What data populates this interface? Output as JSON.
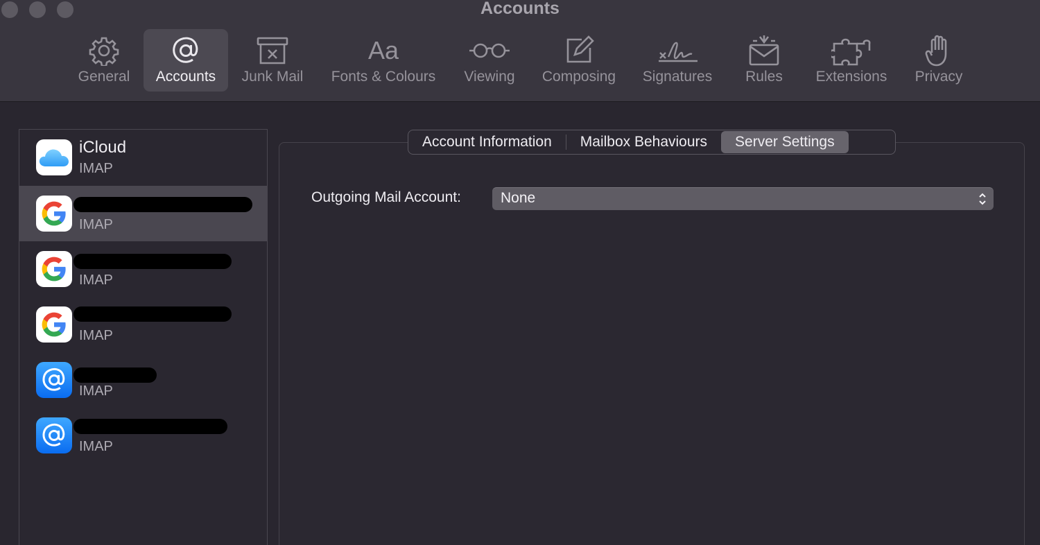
{
  "window": {
    "title": "Accounts"
  },
  "toolbar": {
    "items": [
      {
        "label": "General",
        "icon": "gear-icon"
      },
      {
        "label": "Accounts",
        "icon": "at-icon",
        "active": true
      },
      {
        "label": "Junk Mail",
        "icon": "junk-bin-icon"
      },
      {
        "label": "Fonts & Colours",
        "icon": "fonts-icon"
      },
      {
        "label": "Viewing",
        "icon": "glasses-icon"
      },
      {
        "label": "Composing",
        "icon": "compose-icon"
      },
      {
        "label": "Signatures",
        "icon": "signature-icon"
      },
      {
        "label": "Rules",
        "icon": "rules-envelope-icon"
      },
      {
        "label": "Extensions",
        "icon": "puzzle-icon"
      },
      {
        "label": "Privacy",
        "icon": "hand-icon"
      }
    ]
  },
  "sidebar": {
    "accounts": [
      {
        "name": "iCloud",
        "type": "IMAP",
        "icon": "icloud-icon"
      },
      {
        "name": "",
        "type": "IMAP",
        "icon": "google-icon",
        "selected": true,
        "redacted": true
      },
      {
        "name": "",
        "type": "IMAP",
        "icon": "google-icon",
        "redacted": true
      },
      {
        "name": "",
        "type": "IMAP",
        "icon": "google-icon",
        "redacted": true
      },
      {
        "name": "",
        "type": "IMAP",
        "icon": "at-mail-icon",
        "redacted": true
      },
      {
        "name": "",
        "type": "IMAP",
        "icon": "at-mail-icon",
        "redacted": true
      }
    ]
  },
  "tabs": [
    {
      "label": "Account Information"
    },
    {
      "label": "Mailbox Behaviours"
    },
    {
      "label": "Server Settings",
      "active": true
    }
  ],
  "server_settings": {
    "outgoing_label": "Outgoing Mail Account:",
    "outgoing_value": "None"
  },
  "colors": {
    "background": "#29262f",
    "toolbar": "#39363f",
    "selected": "#4a4750",
    "accent_blue": "#1a82f7"
  }
}
